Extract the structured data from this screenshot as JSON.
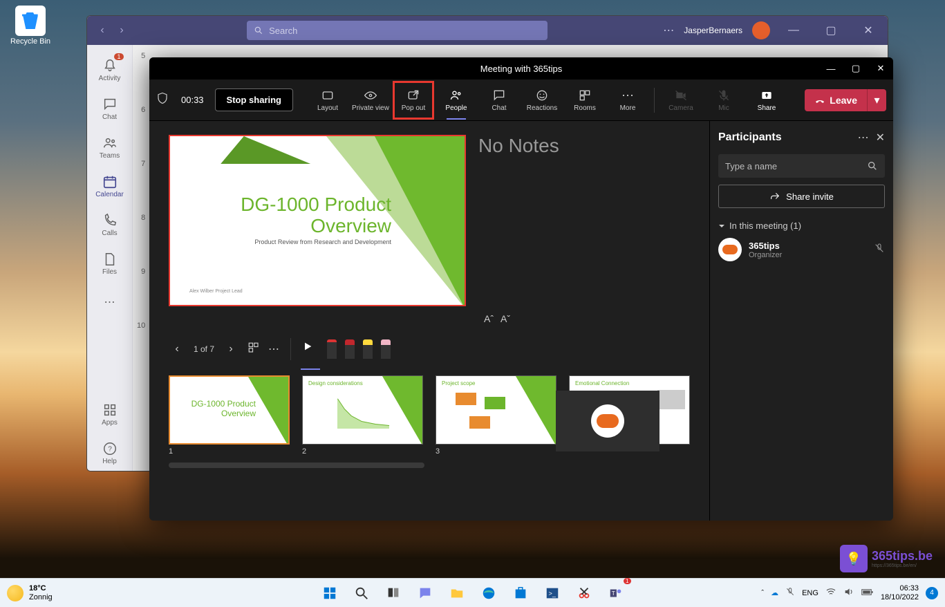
{
  "desktop": {
    "recycle_bin": "Recycle Bin"
  },
  "teams": {
    "search_placeholder": "Search",
    "user_name": "JasperBernaers",
    "sidebar": {
      "activity": "Activity",
      "activity_badge": "1",
      "chat": "Chat",
      "teams": "Teams",
      "calendar": "Calendar",
      "calls": "Calls",
      "files": "Files",
      "apps": "Apps",
      "help": "Help"
    },
    "hours": [
      "5",
      "6",
      "7",
      "8",
      "9",
      "10"
    ]
  },
  "meeting": {
    "title": "Meeting with 365tips",
    "timer": "00:33",
    "stop_sharing": "Stop sharing",
    "toolbar": {
      "layout": "Layout",
      "private_view": "Private view",
      "pop_out": "Pop out",
      "people": "People",
      "chat": "Chat",
      "reactions": "Reactions",
      "rooms": "Rooms",
      "more": "More",
      "camera": "Camera",
      "mic": "Mic",
      "share": "Share",
      "leave": "Leave"
    },
    "slide": {
      "title": "DG-1000 Product Overview",
      "subtitle": "Product Review from Research and Development",
      "footer": "Alex Wilber    Project Lead"
    },
    "no_notes": "No Notes",
    "font_increase": "Aˆ",
    "font_decrease": "Aˇ",
    "page_indicator": "1 of 7",
    "thumbs": {
      "t1": {
        "num": "1",
        "title": "DG-1000 Product Overview"
      },
      "t2": {
        "num": "2",
        "title": "Design considerations"
      },
      "t3": {
        "num": "3",
        "title": "Project scope"
      },
      "t4": {
        "title": "Emotional Connection"
      }
    }
  },
  "participants": {
    "title": "Participants",
    "search_placeholder": "Type a name",
    "share_invite": "Share invite",
    "section": "In this meeting (1)",
    "p1_name": "365tips",
    "p1_role": "Organizer"
  },
  "taskbar": {
    "temp": "18°C",
    "weather": "Zonnig",
    "lang": "ENG",
    "time": "06:33",
    "date": "18/10/2022",
    "notif": "4"
  },
  "watermark": {
    "text": "365tips.be",
    "url": "https://365tips.be/en/"
  }
}
